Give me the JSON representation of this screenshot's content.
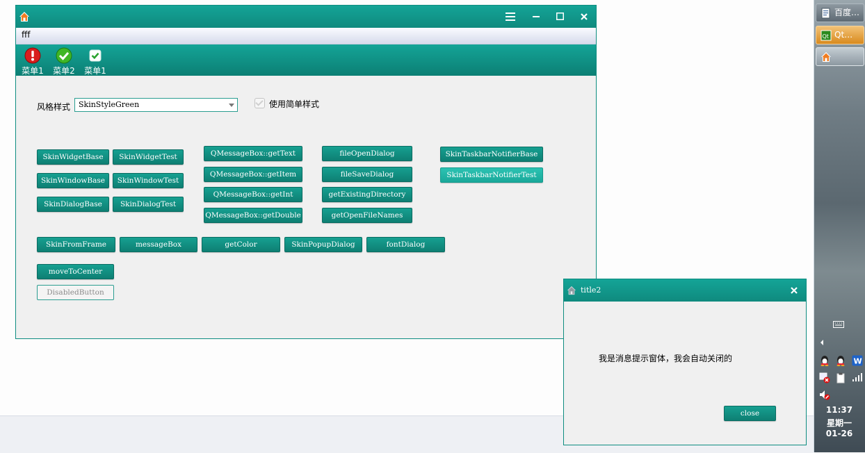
{
  "main_window": {
    "menu": "fff",
    "toolbar": [
      {
        "label": "菜单1",
        "icon": "warning-icon"
      },
      {
        "label": "菜单2",
        "icon": "check-circle-icon"
      },
      {
        "label": "菜单1",
        "icon": "checkbox-icon"
      }
    ],
    "style_label": "风格样式",
    "style_value": "SkinStyleGreen",
    "simple_style_label": "使用简单样式",
    "buttons": {
      "skin_widget_base": "SkinWidgetBase",
      "skin_widget_test": "SkinWidgetTest",
      "skin_window_base": "SkinWindowBase",
      "skin_window_test": "SkinWindowTest",
      "skin_dialog_base": "SkinDialogBase",
      "skin_dialog_test": "SkinDialogTest",
      "get_text": "QMessageBox::getText",
      "get_item": "QMessageBox::getItem",
      "get_int": "QMessageBox::getInt",
      "get_double": "QMessageBox::getDouble",
      "file_open": "fileOpenDialog",
      "file_save": "fileSaveDialog",
      "get_dir": "getExistingDirectory",
      "get_open_names": "getOpenFileNames",
      "notifier_base": "SkinTaskbarNotifierBase",
      "notifier_test": "SkinTaskbarNotifierTest",
      "from_frame": "SkinFromFrame",
      "message_box": "messageBox",
      "get_color": "getColor",
      "popup_dialog": "SkinPopupDialog",
      "font_dialog": "fontDialog",
      "move_center": "moveToCenter",
      "disabled": "DisabledButton"
    }
  },
  "popup": {
    "title": "title2",
    "message": "我是消息提示窗体，我会自动关闭的",
    "close_label": "close"
  },
  "taskbar": {
    "items": [
      "百度…",
      "Qt…",
      ""
    ],
    "time": "11:37",
    "weekday": "星期一",
    "date": "01-26"
  },
  "colors": {
    "accent": "#12978a",
    "accent_light": "#22b5a6"
  }
}
